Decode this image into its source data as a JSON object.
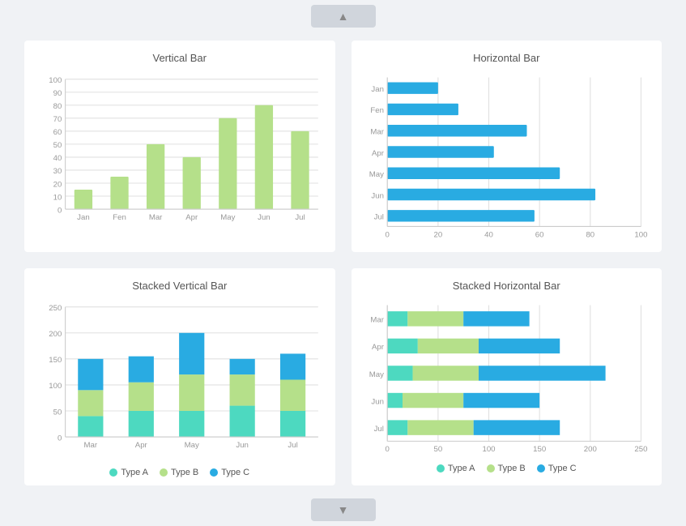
{
  "scroll_up_label": "▲",
  "scroll_down_label": "▼",
  "charts": [
    {
      "id": "vertical-bar",
      "title": "Vertical Bar",
      "type": "vertical-bar",
      "months": [
        "Jan",
        "Fen",
        "Mar",
        "Apr",
        "May",
        "Jun",
        "Jul"
      ],
      "values": [
        15,
        25,
        50,
        40,
        70,
        80,
        60
      ],
      "color": "#b5e08a",
      "yMax": 100,
      "yTicks": [
        0,
        10,
        20,
        30,
        40,
        50,
        60,
        70,
        80,
        90,
        100
      ]
    },
    {
      "id": "horizontal-bar",
      "title": "Horizontal Bar",
      "type": "horizontal-bar",
      "months": [
        "Jan",
        "Fen",
        "Mar",
        "Apr",
        "May",
        "Jun",
        "Jul"
      ],
      "values": [
        20,
        28,
        55,
        42,
        68,
        82,
        58
      ],
      "color": "#29abe2",
      "xMax": 100,
      "xTicks": [
        0,
        20,
        40,
        60,
        80,
        100
      ]
    },
    {
      "id": "stacked-vertical-bar",
      "title": "Stacked Vertical Bar",
      "type": "stacked-vertical-bar",
      "months": [
        "Mar",
        "Apr",
        "May",
        "Jun",
        "Jul"
      ],
      "series": [
        {
          "label": "Type A",
          "color": "#4dd9c0",
          "values": [
            40,
            50,
            50,
            60,
            50
          ]
        },
        {
          "label": "Type B",
          "color": "#b5e08a",
          "values": [
            50,
            55,
            70,
            60,
            60
          ]
        },
        {
          "label": "Type C",
          "color": "#29abe2",
          "values": [
            60,
            50,
            80,
            30,
            50
          ]
        }
      ],
      "yMax": 250,
      "yTicks": [
        0,
        50,
        100,
        150,
        200,
        250
      ]
    },
    {
      "id": "stacked-horizontal-bar",
      "title": "Stacked Horizontal Bar",
      "type": "stacked-horizontal-bar",
      "months": [
        "Mar",
        "Apr",
        "May",
        "Jun",
        "Jul"
      ],
      "series": [
        {
          "label": "Type A",
          "color": "#4dd9c0",
          "values": [
            20,
            30,
            25,
            15,
            20
          ]
        },
        {
          "label": "Type B",
          "color": "#b5e08a",
          "values": [
            55,
            60,
            65,
            60,
            65
          ]
        },
        {
          "label": "Type C",
          "color": "#29abe2",
          "values": [
            65,
            80,
            125,
            75,
            85
          ]
        }
      ],
      "xMax": 250,
      "xTicks": [
        0,
        50,
        100,
        150,
        200,
        250
      ]
    }
  ]
}
